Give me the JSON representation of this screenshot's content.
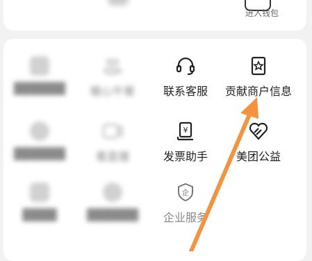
{
  "wallet": {
    "label": "进入钱包",
    "icon": "wallet-icon"
  },
  "services": [
    {
      "label": "联系客服",
      "icon": "headset-icon"
    },
    {
      "label": "贡献商户信息",
      "icon": "store-star-icon"
    },
    {
      "label": "发票助手",
      "icon": "invoice-icon"
    },
    {
      "label": "美团公益",
      "icon": "charity-heart-icon"
    },
    {
      "label": "企业服务",
      "icon": "enterprise-shield-icon"
    }
  ],
  "blurred_services": [
    {
      "label": "暖心午餐",
      "icon": "hand-heart-icon"
    },
    {
      "label": "看直播",
      "icon": "live-video-icon"
    }
  ],
  "annotation": {
    "color": "#f5923e",
    "target": "贡献商户信息"
  }
}
